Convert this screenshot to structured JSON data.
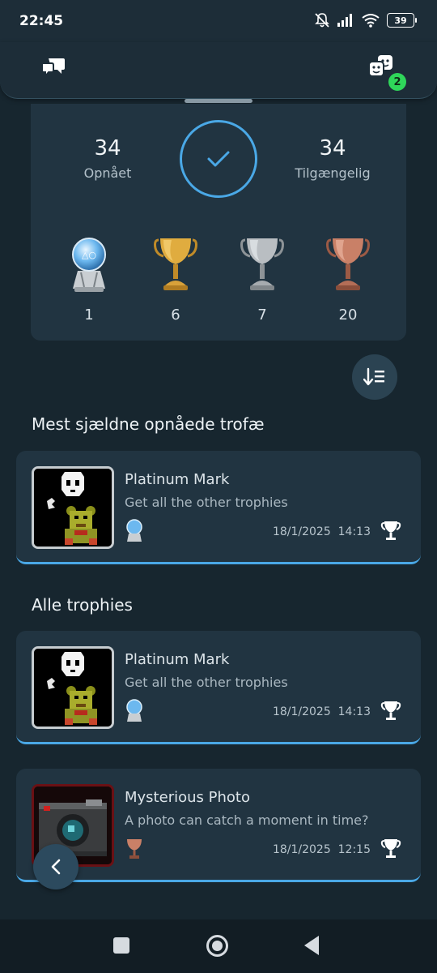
{
  "status_bar": {
    "time": "22:45",
    "battery": "39",
    "icons": [
      "bell-muted-icon",
      "signal-icon",
      "wifi-icon",
      "battery-icon"
    ]
  },
  "top_bar": {
    "left_icon": "chat-bubbles-icon",
    "right_icon": "friends-icon",
    "friends_badge": "2"
  },
  "summary": {
    "earned_count": "34",
    "earned_label": "Opnået",
    "available_count": "34",
    "available_label": "Tilgængelig",
    "completion_icon": "check-icon",
    "grades": [
      {
        "grade": "platinum",
        "count": "1",
        "color": "#8fd0ff"
      },
      {
        "grade": "gold",
        "count": "6",
        "color": "#d9a53a"
      },
      {
        "grade": "silver",
        "count": "7",
        "color": "#b9bec2"
      },
      {
        "grade": "bronze",
        "count": "20",
        "color": "#c98067"
      }
    ]
  },
  "sort_button_icon": "sort-icon",
  "sections": {
    "rarest_title": "Mest sjældne opnåede trofæ",
    "all_title": "Alle trophies"
  },
  "rarest": [
    {
      "title": "Platinum Mark",
      "description": "Get all the other trophies",
      "date": "18/1/2025",
      "time": "14:13",
      "grade": "platinum"
    }
  ],
  "all": [
    {
      "title": "Platinum Mark",
      "description": "Get all the other trophies",
      "date": "18/1/2025",
      "time": "14:13",
      "grade": "platinum"
    },
    {
      "title": "Mysterious Photo",
      "description": "A photo can catch a moment in time?",
      "date": "18/1/2025",
      "time": "12:15",
      "grade": "bronze"
    }
  ],
  "colors": {
    "accent": "#4aa8e6",
    "card": "#213441",
    "background": "#17262f",
    "badge": "#2fd65a"
  },
  "nav_bar": {
    "icons": [
      "recents-icon",
      "home-icon",
      "back-icon"
    ]
  }
}
